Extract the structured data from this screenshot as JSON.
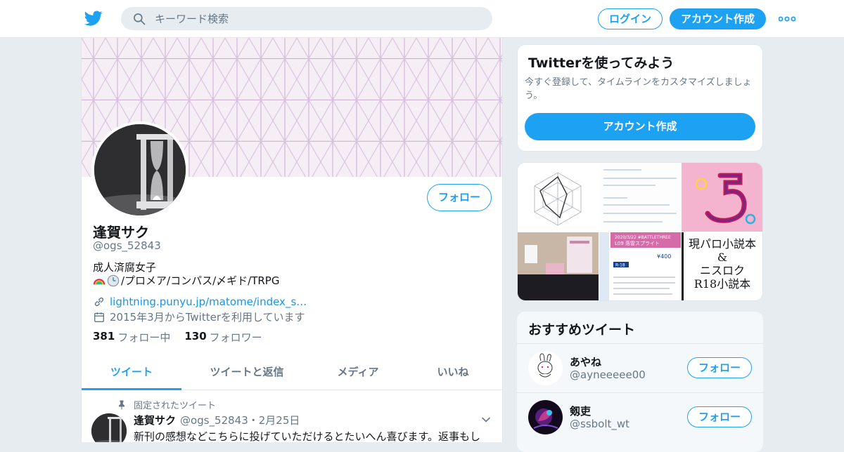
{
  "header": {
    "search_placeholder": "キーワード検索",
    "login_label": "ログイン",
    "signup_label": "アカウント作成"
  },
  "profile": {
    "name": "逢賀サク",
    "handle": "@ogs_52843",
    "bio_line1": "成人済腐女子",
    "bio_line2": "/プロメア/コンパス/〆ギド/TRPG",
    "link": "lightning.punyu.jp/matome/index_s…",
    "joined": "2015年3月からTwitterを利用しています",
    "following_count": "381",
    "following_label": "フォロー中",
    "followers_count": "130",
    "followers_label": "フォロワー",
    "follow_label": "フォロー"
  },
  "tabs": [
    {
      "label": "ツイート"
    },
    {
      "label": "ツイートと返信"
    },
    {
      "label": "メディア"
    },
    {
      "label": "いいね"
    }
  ],
  "pinned_tweet": {
    "pinned_label": "固定されたツイート",
    "name": "逢賀サク",
    "meta": "@ogs_52843・2月25日",
    "text": "新刊の感想などこちらに投げていただけるとたいへん喜びます。返事もし"
  },
  "sidebar": {
    "signup_card": {
      "title": "Twitterを使ってみよう",
      "desc": "今すぐ登録して、タイムラインをカスタマイズしましょう。",
      "button": "アカウント作成"
    },
    "media_tile_text": {
      "t1": "2020/3/22 #BATTLETHREE",
      "t2": "L09 落雷スプライト",
      "t3": "¥400",
      "t4": "R-18",
      "big1": "現パロ小説本",
      "big2": "&",
      "big3": "ニスロク",
      "big4": "R18小説本"
    },
    "recommend": {
      "title": "おすすめツイート",
      "users": [
        {
          "name": "あやね",
          "handle": "@ayneeeee00",
          "button": "フォロー"
        },
        {
          "name": "剱吏",
          "handle": "@ssbolt_wt",
          "button": "フォロー"
        }
      ]
    }
  },
  "colors": {
    "accent": "#1da1f2",
    "muted": "#657786",
    "banner": "#f6eef5"
  }
}
